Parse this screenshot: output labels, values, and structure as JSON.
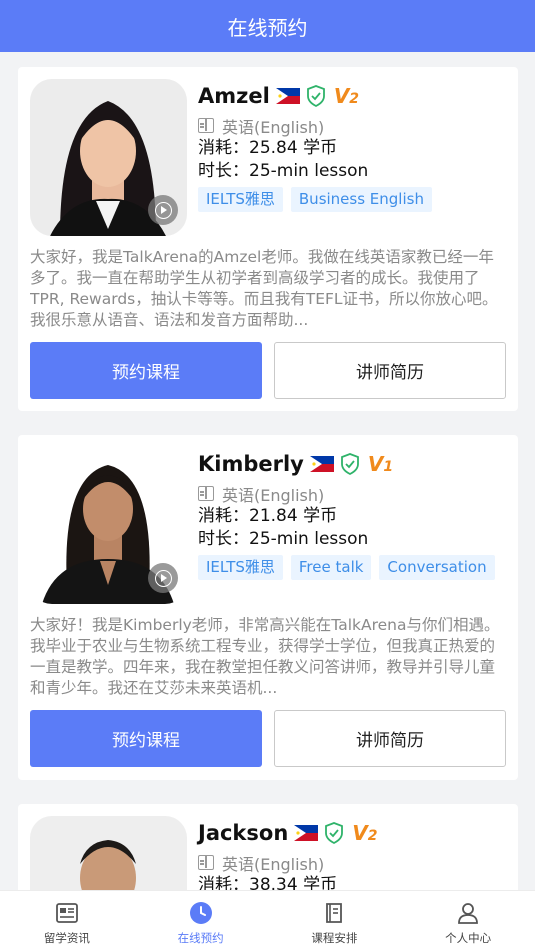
{
  "header": {
    "title": "在线预约"
  },
  "teachers": [
    {
      "name": "Amzel",
      "level": "2",
      "language": "英语(English)",
      "cost": "消耗：25.84 学币",
      "duration": "时长：25-min lesson",
      "tags": [
        "IELTS雅思",
        "Business English"
      ],
      "intro": "大家好，我是TalkArena的Amzel老师。我做在线英语家教已经一年多了。我一直在帮助学生从初学者到高级学习者的成长。我使用了TPR, Rewards，抽认卡等等。而且我有TEFL证书，所以你放心吧。我很乐意从语音、语法和发音方面帮助..."
    },
    {
      "name": "Kimberly",
      "level": "1",
      "language": "英语(English)",
      "cost": "消耗：21.84 学币",
      "duration": "时长：25-min lesson",
      "tags": [
        "IELTS雅思",
        "Free talk",
        "Conversation"
      ],
      "intro": "大家好！我是Kimberly老师，非常高兴能在TalkArena与你们相遇。我毕业于农业与生物系统工程专业，获得学士学位，但我真正热爱的一直是教学。四年来，我在教堂担任教义问答讲师，教导并引导儿童和青少年。我还在艾莎未来英语机..."
    },
    {
      "name": "Jackson",
      "level": "2",
      "language": "英语(English)",
      "cost": "消耗：38.34 学币"
    }
  ],
  "buttons": {
    "book": "预约课程",
    "cv": "讲师简历"
  },
  "tabbar": [
    {
      "label": "留学资讯",
      "icon": "news-icon"
    },
    {
      "label": "在线预约",
      "icon": "clock-icon"
    },
    {
      "label": "课程安排",
      "icon": "schedule-icon"
    },
    {
      "label": "个人中心",
      "icon": "user-icon"
    }
  ],
  "colors": {
    "primary": "#5b7cf7",
    "tag_bg": "#eaf4ff",
    "tag_text": "#3e8ee8",
    "badge": "#f08a1c",
    "verified": "#2fb36a"
  }
}
